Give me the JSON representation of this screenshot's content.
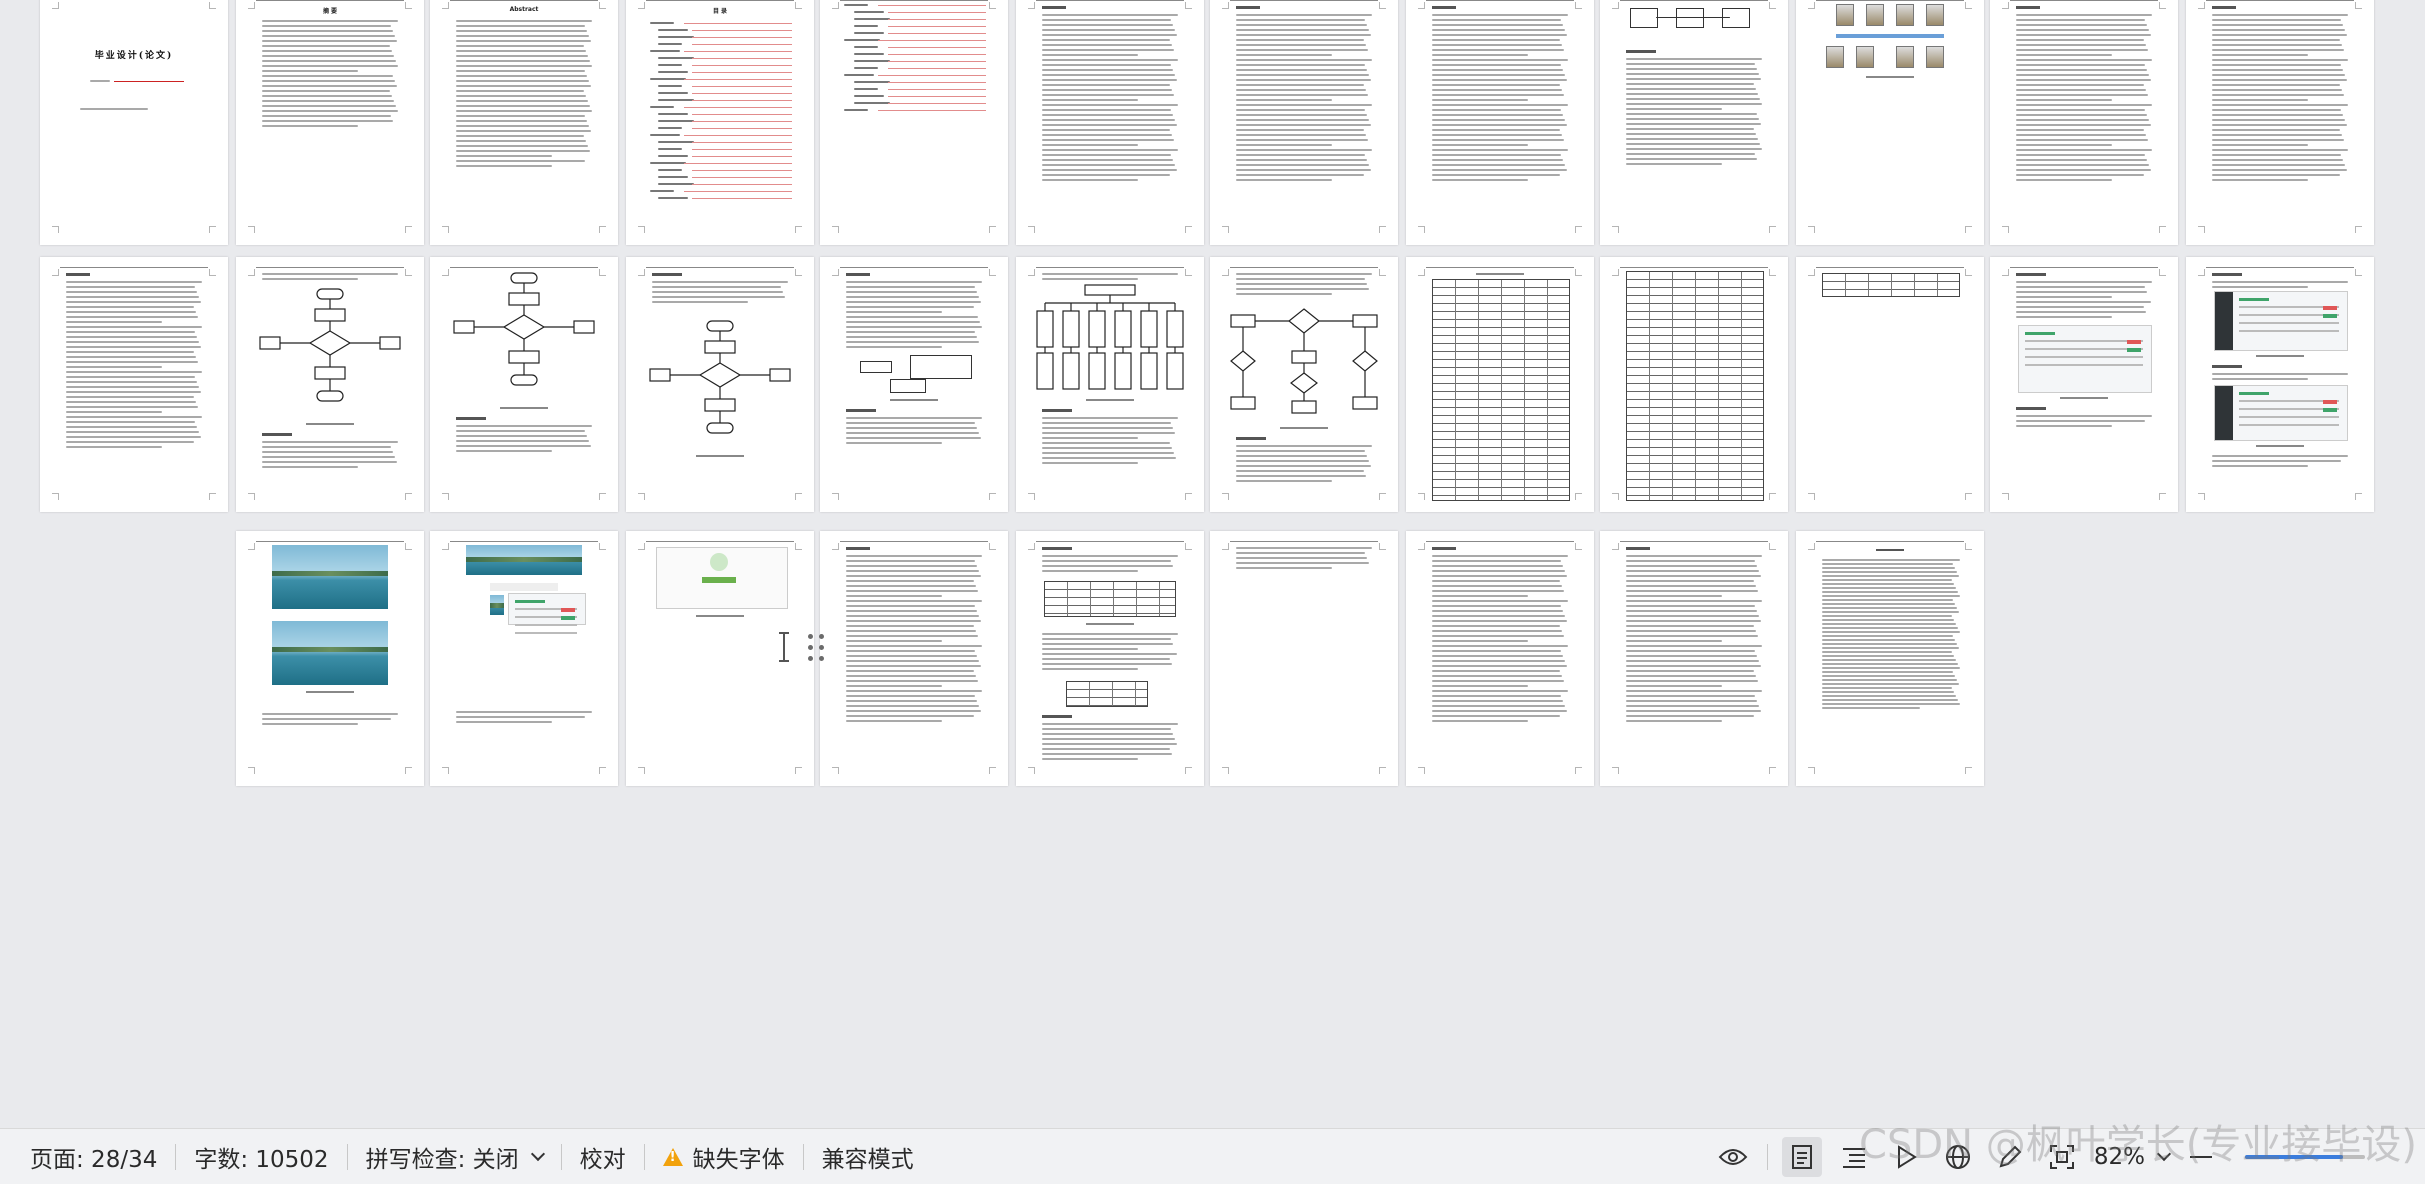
{
  "statusbar": {
    "page_label": "页面: 28/34",
    "word_count_label": "字数: 10502",
    "spellcheck_label": "拼写检查: 关闭",
    "proofread_label": "校对",
    "missing_font_label": "缺失字体",
    "compat_label": "兼容模式",
    "zoom_label": "82%",
    "zoom_fraction": 0.82
  },
  "watermark": "CSDN @枫叶学长(专业接毕设)",
  "document": {
    "cover_title": "毕业设计(论文)",
    "abstract_title": "摘  要",
    "abstract_en_title": "Abstract",
    "toc_title": "目  录"
  },
  "icons": [
    "eye-icon",
    "page-view-icon",
    "outline-icon",
    "play-icon",
    "web-icon",
    "pen-icon",
    "fit-icon",
    "zoom-out-icon"
  ]
}
